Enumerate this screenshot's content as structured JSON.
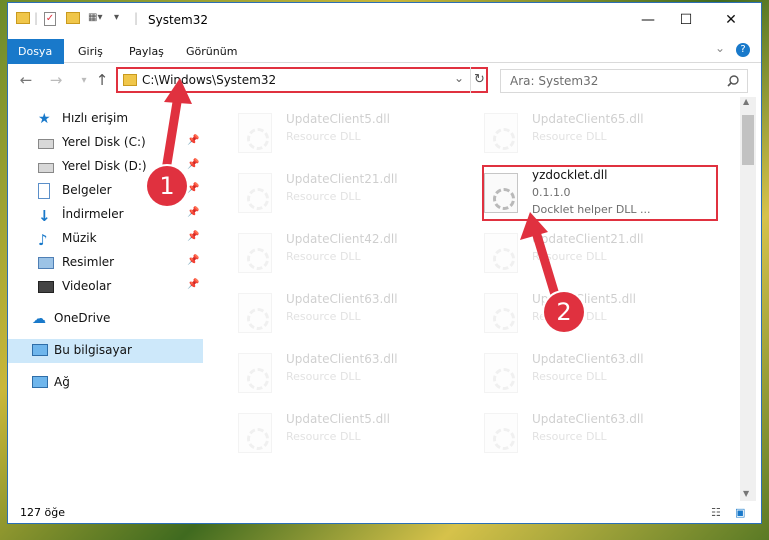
{
  "window": {
    "title": "System32"
  },
  "controls": {
    "minimize": "—",
    "maximize": "☐",
    "close": "✕"
  },
  "ribbon": {
    "tabs": [
      "Dosya",
      "Giriş",
      "Paylaş",
      "Görünüm"
    ],
    "help": "?",
    "expand": "⌄"
  },
  "nav": {
    "back": "←",
    "forward": "→",
    "up": "↑",
    "address": "C:\\Windows\\System32",
    "dropdown": "⌄",
    "refresh": "↻"
  },
  "search": {
    "placeholder": "Ara: System32",
    "icon": "search-icon"
  },
  "sidebar": {
    "items": [
      {
        "label": "Hızlı erişim",
        "icon": "star-icon",
        "pinned": false
      },
      {
        "label": "Yerel Disk (C:)",
        "icon": "drive-icon",
        "pinned": true
      },
      {
        "label": "Yerel Disk (D:)",
        "icon": "drive-icon",
        "pinned": true
      },
      {
        "label": "Belgeler",
        "icon": "documents-icon",
        "pinned": true
      },
      {
        "label": "İndirmeler",
        "icon": "download-icon",
        "pinned": true
      },
      {
        "label": "Müzik",
        "icon": "music-icon",
        "pinned": true
      },
      {
        "label": "Resimler",
        "icon": "pictures-icon",
        "pinned": true
      },
      {
        "label": "Videolar",
        "icon": "videos-icon",
        "pinned": true
      },
      {
        "label": "OneDrive",
        "icon": "cloud-icon",
        "pinned": false
      },
      {
        "label": "Bu bilgisayar",
        "icon": "computer-icon",
        "pinned": false
      },
      {
        "label": "Ağ",
        "icon": "network-icon",
        "pinned": false
      }
    ],
    "pin_glyph": "📌"
  },
  "files": [
    {
      "name": "UpdateClient5.dll",
      "desc": "Resource DLL"
    },
    {
      "name": "UpdateClient65.dll",
      "desc": "Resource DLL"
    },
    {
      "name": "UpdateClient21.dll",
      "desc": "Resource DLL"
    },
    {
      "name": "yzdocklet.dll",
      "version": "0.1.1.0",
      "desc": "Docklet helper DLL ..."
    },
    {
      "name": "UpdateClient42.dll",
      "desc": "Resource DLL"
    },
    {
      "name": "UpdateClient21.dll",
      "desc": "Resource DLL"
    },
    {
      "name": "UpdateClient63.dll",
      "desc": "Resource DLL"
    },
    {
      "name": "UpdateClient5.dll",
      "desc": "Resource DLL"
    },
    {
      "name": "UpdateClient63.dll",
      "desc": "Resource DLL"
    },
    {
      "name": "UpdateClient63.dll",
      "desc": "Resource DLL"
    },
    {
      "name": "UpdateClient5.dll",
      "desc": "Resource DLL"
    },
    {
      "name": "UpdateClient63.dll",
      "desc": "Resource DLL"
    }
  ],
  "status": {
    "count": "127 öğe"
  },
  "annotations": {
    "marker1": "1",
    "marker2": "2",
    "color": "#e0313f"
  }
}
